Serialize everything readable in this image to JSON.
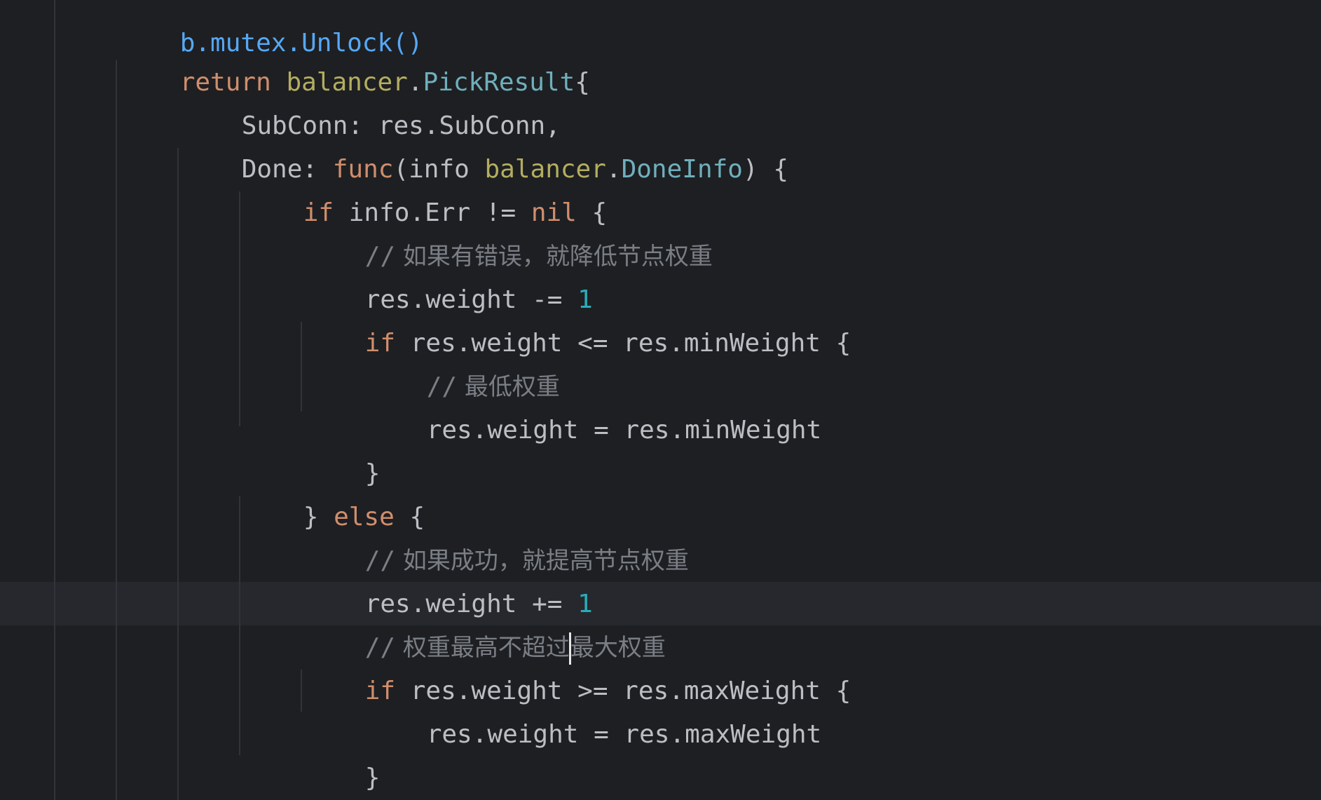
{
  "colors": {
    "background": "#1e1f22",
    "keyword": "#cf8e6d",
    "package": "#b3ae60",
    "type": "#6fafbd",
    "number": "#2aacb8",
    "comment": "#7a7e85",
    "text": "#bcbec4"
  },
  "code": {
    "l0": {
      "t": "b.mutex.Unlock()"
    },
    "l1": {
      "kw": "return",
      "sp": " ",
      "pkg": "balancer",
      "dot": ".",
      "type": "PickResult",
      "rest": "{"
    },
    "l2": {
      "t": "SubConn: res.SubConn,"
    },
    "l3": {
      "a": "Done: ",
      "kw": "func",
      "b": "(info ",
      "pkg": "balancer",
      "dot": ".",
      "type": "DoneInfo",
      "c": ") {"
    },
    "l4": {
      "kw": "if",
      "a": " info.Err != ",
      "kw2": "nil",
      "b": " {"
    },
    "l5": {
      "slash": "//",
      "cmt": " 如果有错误，就降低节点权重"
    },
    "l6": {
      "a": "res.weight -= ",
      "num": "1"
    },
    "l7": {
      "kw": "if",
      "a": " res.weight <= res.minWeight {"
    },
    "l8": {
      "slash": "//",
      "cmt": " 最低权重"
    },
    "l9": {
      "t": "res.weight = res.minWeight"
    },
    "l10": {
      "t": "}"
    },
    "l11": {
      "a": "} ",
      "kw": "else",
      "b": " {"
    },
    "l12": {
      "slash": "//",
      "cmt": " 如果成功，就提高节点权重"
    },
    "l13": {
      "a": "res.weight += ",
      "num": "1"
    },
    "l14": {
      "slash": "//",
      "cmt_before_caret": " 权重最高不超过",
      "cmt_after_caret": "最大权重"
    },
    "l15": {
      "kw": "if",
      "a": " res.weight >= res.maxWeight {"
    },
    "l16": {
      "t": "res.weight = res.maxWeight"
    },
    "l17": {
      "t": "}"
    },
    "l18": {
      "t": "}"
    }
  }
}
